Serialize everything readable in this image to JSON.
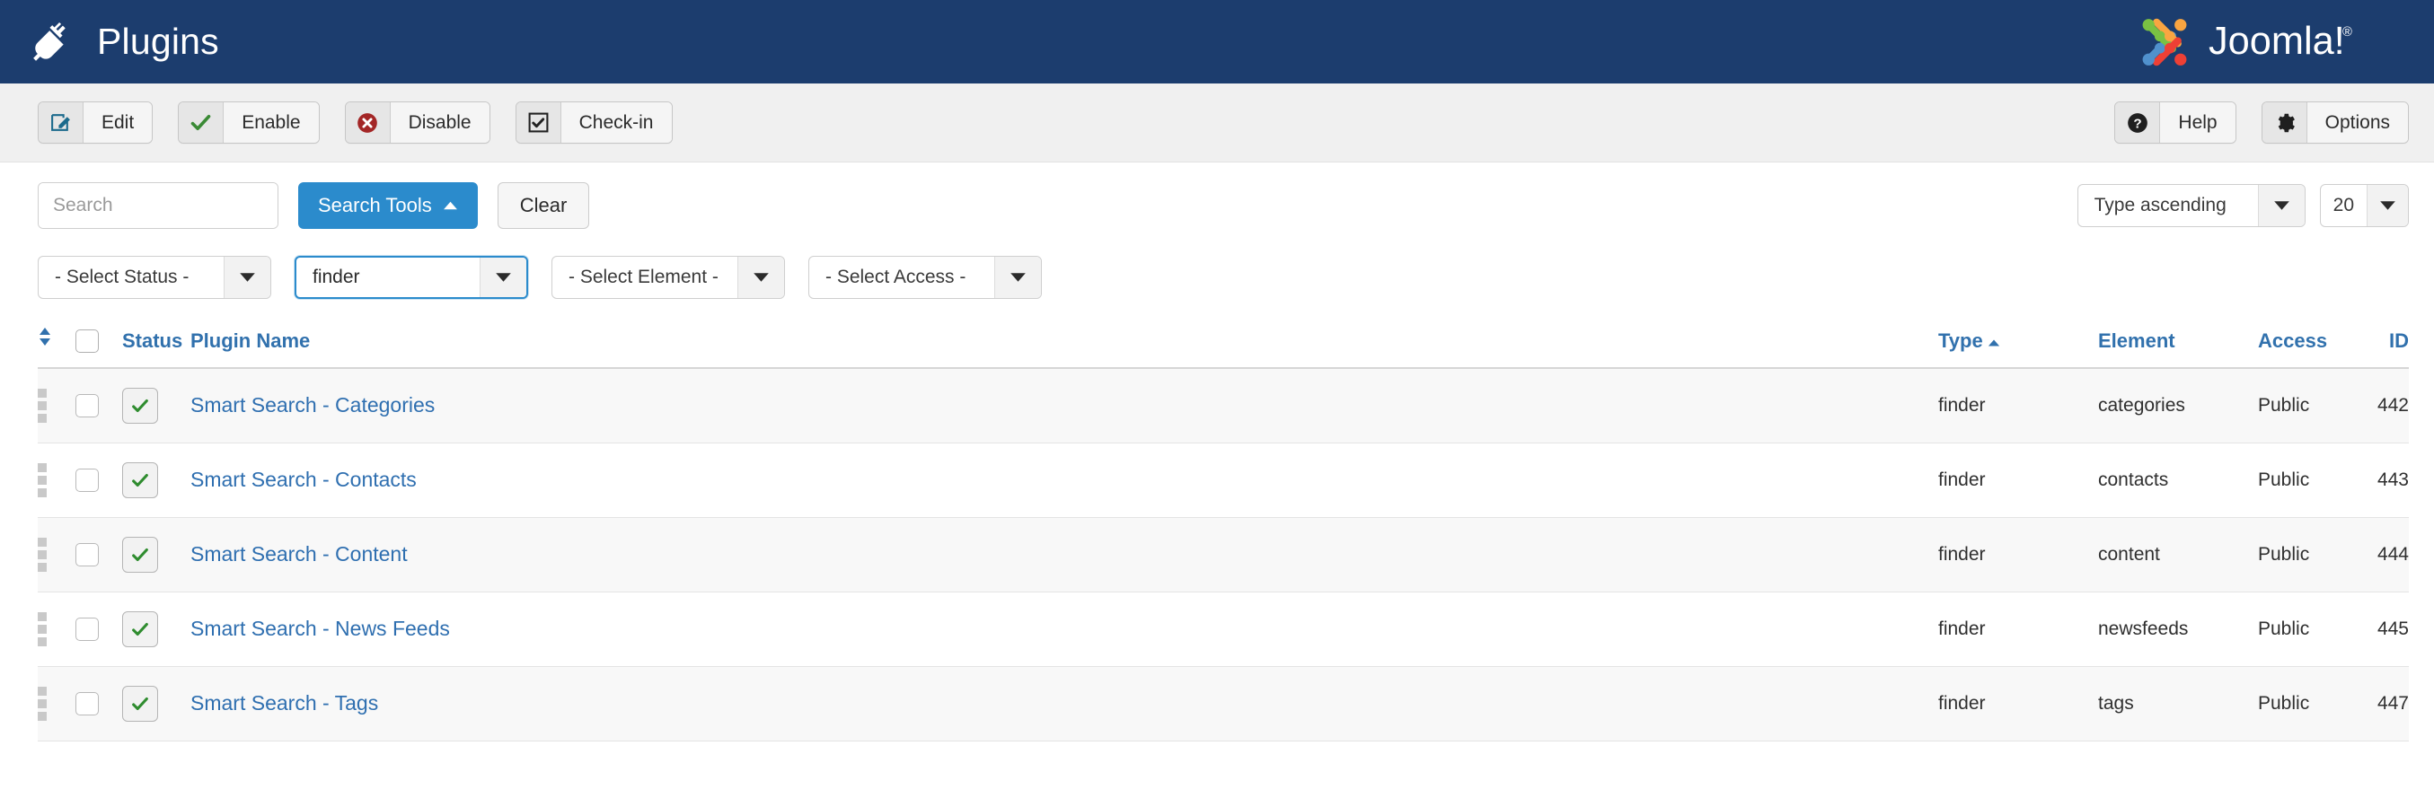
{
  "header": {
    "title": "Plugins",
    "icon": "plug-icon",
    "brand": "Joomla!",
    "brand_trademark": "®",
    "bg_color": "#1c3d6e",
    "logo_colors": {
      "green": "#7ac143",
      "orange": "#f9a541",
      "blue": "#5091cd",
      "red": "#ee4035"
    }
  },
  "toolbar": {
    "left_buttons": [
      {
        "label": "Edit",
        "icon": "edit-pencil-icon"
      },
      {
        "label": "Enable",
        "icon": "check-icon"
      },
      {
        "label": "Disable",
        "icon": "circle-x-icon"
      },
      {
        "label": "Check-in",
        "icon": "checkbox-icon"
      }
    ],
    "right_buttons": [
      {
        "label": "Help",
        "icon": "question-circle-icon"
      },
      {
        "label": "Options",
        "icon": "gear-icon"
      }
    ]
  },
  "search": {
    "placeholder": "Search",
    "value": "",
    "search_icon": "magnifier-icon",
    "search_tools_label": "Search Tools",
    "search_tools_caret": "chevron-up-icon",
    "clear_label": "Clear",
    "accent_color": "#2b8bcc"
  },
  "ordering": {
    "sort_value": "Type ascending",
    "limit_value": "20"
  },
  "filters": [
    {
      "name": "status",
      "value": "- Select Status -",
      "focused": false
    },
    {
      "name": "type",
      "value": "finder",
      "focused": true
    },
    {
      "name": "element",
      "value": "- Select Element -",
      "focused": false
    },
    {
      "name": "access",
      "value": "- Select Access -",
      "focused": false
    }
  ],
  "table": {
    "headers": {
      "ordering": "",
      "checkall": "",
      "status": "Status",
      "name": "Plugin Name",
      "type": "Type",
      "element": "Element",
      "access": "Access",
      "id": "ID"
    },
    "active_sort_column": "Type",
    "active_sort_direction": "ascending",
    "rows": [
      {
        "name": "Smart Search - Categories",
        "type": "finder",
        "element": "categories",
        "access": "Public",
        "id": "442",
        "status": "enabled"
      },
      {
        "name": "Smart Search - Contacts",
        "type": "finder",
        "element": "contacts",
        "access": "Public",
        "id": "443",
        "status": "enabled"
      },
      {
        "name": "Smart Search - Content",
        "type": "finder",
        "element": "content",
        "access": "Public",
        "id": "444",
        "status": "enabled"
      },
      {
        "name": "Smart Search - News Feeds",
        "type": "finder",
        "element": "newsfeeds",
        "access": "Public",
        "id": "445",
        "status": "enabled"
      },
      {
        "name": "Smart Search - Tags",
        "type": "finder",
        "element": "tags",
        "access": "Public",
        "id": "447",
        "status": "enabled"
      }
    ]
  }
}
